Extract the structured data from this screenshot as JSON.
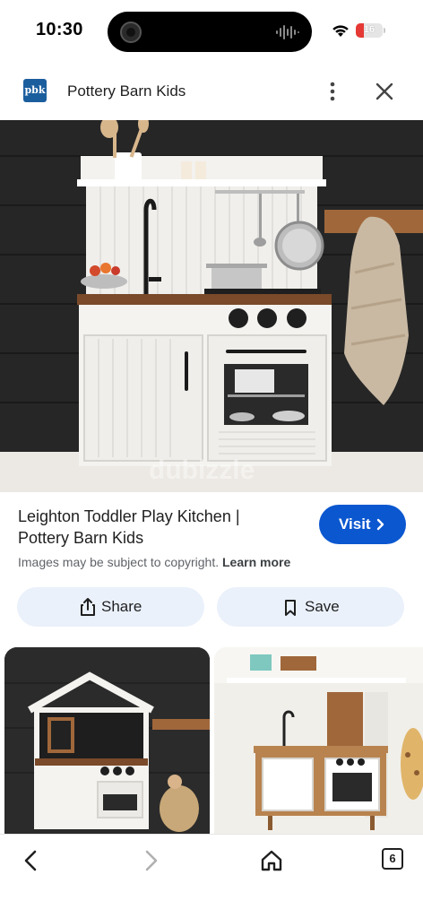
{
  "status": {
    "time": "10:30",
    "battery": "16",
    "battery_color": "#e53935"
  },
  "header": {
    "logo_text": "pbk",
    "site_name": "Pottery Barn Kids",
    "logo_color": "#1b5e9e"
  },
  "image": {
    "watermark": "dubizzle"
  },
  "result": {
    "title_line1": "Leighton Toddler Play Kitchen |",
    "title_line2": "Pottery Barn Kids",
    "visit_label": "Visit",
    "copyright_text": "Images may be subject to copyright.",
    "learn_more": "Learn more"
  },
  "actions": {
    "share_label": "Share",
    "save_label": "Save"
  },
  "toolbar": {
    "tab_count": "6"
  },
  "colors": {
    "accent": "#0b57d0",
    "chip_bg": "#eaf1fb"
  }
}
